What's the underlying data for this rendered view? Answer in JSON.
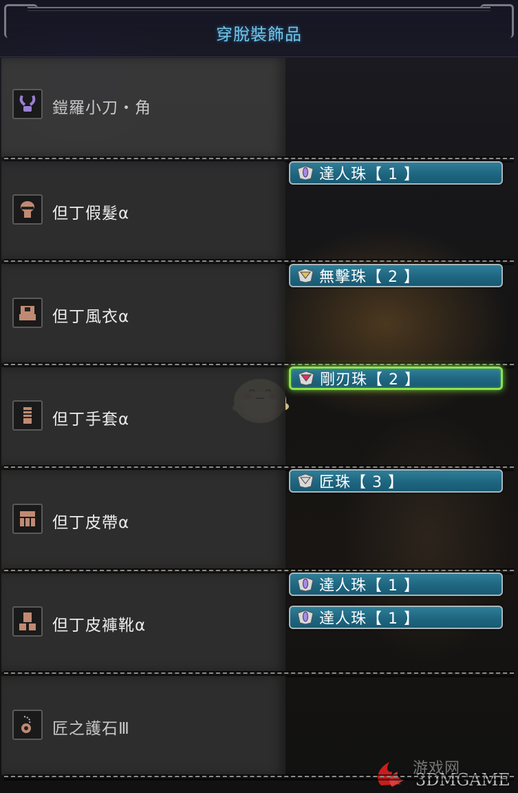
{
  "screen": {
    "title": "穿脫裝飾品"
  },
  "equipment": [
    {
      "icon": "weapon-icon",
      "name": "鎧羅小刀・角",
      "decorations": []
    },
    {
      "icon": "helm-icon",
      "name": "但丁假髮α",
      "decorations": [
        {
          "label": "達人珠【 1 】",
          "level": 1,
          "gem": "purple"
        }
      ]
    },
    {
      "icon": "chest-icon",
      "name": "但丁風衣α",
      "decorations": [
        {
          "label": "無擊珠【 2 】",
          "level": 2,
          "gem": "gold"
        }
      ]
    },
    {
      "icon": "arms-icon",
      "name": "但丁手套α",
      "decorations": [
        {
          "label": "剛刃珠【 2 】",
          "level": 2,
          "gem": "red",
          "selected": true
        }
      ]
    },
    {
      "icon": "waist-icon",
      "name": "但丁皮帶α",
      "decorations": [
        {
          "label": "匠珠【 3 】",
          "level": 3,
          "gem": "silver"
        }
      ]
    },
    {
      "icon": "legs-icon",
      "name": "但丁皮褲靴α",
      "decorations": [
        {
          "label": "達人珠【 1 】",
          "level": 1,
          "gem": "purple"
        },
        {
          "label": "達人珠【 1 】",
          "level": 1,
          "gem": "purple"
        }
      ]
    },
    {
      "icon": "charm-icon",
      "name": "匠之護石Ⅲ",
      "decorations": []
    }
  ],
  "watermark": {
    "text": "3DMGAME",
    "cn": "游戏网"
  },
  "colors": {
    "title": "#6fc6ea",
    "slot_bg": "#1f6680",
    "selected_glow": "#8fe34a",
    "gem_purple": "#a58be0",
    "gem_gold": "#e0c25a",
    "gem_red": "#d8346a",
    "gem_silver": "#d8d8d8"
  }
}
